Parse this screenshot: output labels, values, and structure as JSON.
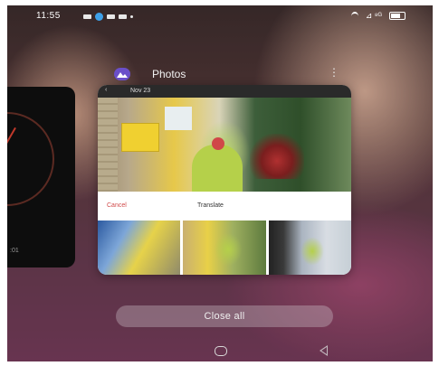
{
  "status_bar": {
    "time": "11:55",
    "right_text": "⊿ ⁸ᴳ"
  },
  "left_card": {
    "text": ":01"
  },
  "app": {
    "name": "Photos",
    "icon": "photos-icon",
    "menu_icon": "more-vertical-icon",
    "menu_glyph": "⋮"
  },
  "card": {
    "back_glyph": "‹",
    "date": "Nov 23",
    "cancel_label": "Cancel",
    "translate_label": "Translate"
  },
  "close_all_label": "Close all",
  "colors": {
    "accent": "#6a4fc9",
    "cancel": "#d14a4a"
  }
}
